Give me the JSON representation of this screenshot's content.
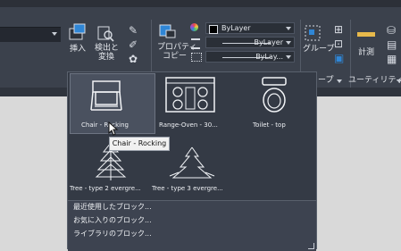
{
  "ribbon": {
    "insert_label": "挿入",
    "search_label_1": "検出と",
    "search_label_2": "変換",
    "properties_label_1": "プロパティ",
    "properties_label_2": "コピー",
    "layer_color": "ByLayer",
    "linetype": "ByLayer",
    "lineweight": "ByLay...",
    "group_label": "グループ",
    "measure_label": "計測",
    "group_section_tail": "ープ",
    "utility_label": "ユーティリティ"
  },
  "blocks": {
    "items": [
      {
        "label": "Chair - Rocking"
      },
      {
        "label": "Range-Oven - 30..."
      },
      {
        "label": "Toilet - top"
      },
      {
        "label": "Tree - type 2 evergre..."
      },
      {
        "label": "Tree - type 3 evergre..."
      }
    ],
    "tooltip": "Chair - Rocking",
    "footer": [
      "最近使用したブロック...",
      "お気に入りのブロック...",
      "ライブラリのブロック..."
    ]
  },
  "colors": {
    "ribbon_bg": "#3b414c",
    "panel_bg": "#343a45",
    "accent": "#2f86d6"
  }
}
